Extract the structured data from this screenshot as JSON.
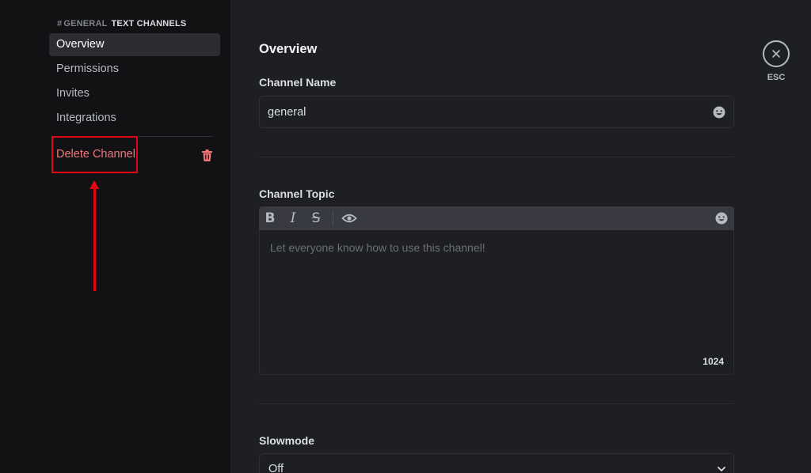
{
  "sidebar": {
    "header": {
      "hash": "#",
      "channel": "GENERAL",
      "section": "TEXT CHANNELS"
    },
    "items": [
      {
        "label": "Overview",
        "selected": true
      },
      {
        "label": "Permissions"
      },
      {
        "label": "Invites"
      },
      {
        "label": "Integrations"
      }
    ],
    "delete_label": "Delete Channel"
  },
  "main": {
    "title": "Overview",
    "channel_name": {
      "label": "Channel Name",
      "value": "general"
    },
    "channel_topic": {
      "label": "Channel Topic",
      "placeholder": "Let everyone know how to use this channel!",
      "remaining_chars": "1024",
      "toolbar": {
        "bold": "B",
        "italic": "I",
        "strikethrough": "S"
      }
    },
    "slowmode": {
      "label": "Slowmode",
      "value": "Off"
    }
  },
  "close": {
    "esc_label": "ESC"
  },
  "colors": {
    "sidebar_bg": "#121214",
    "main_bg": "#1e1f22",
    "danger": "#f2767a",
    "annotation": "#e3050f"
  },
  "icons": [
    "trash-icon",
    "emoji-icon",
    "eye-icon",
    "chevron-down-icon",
    "close-icon"
  ]
}
